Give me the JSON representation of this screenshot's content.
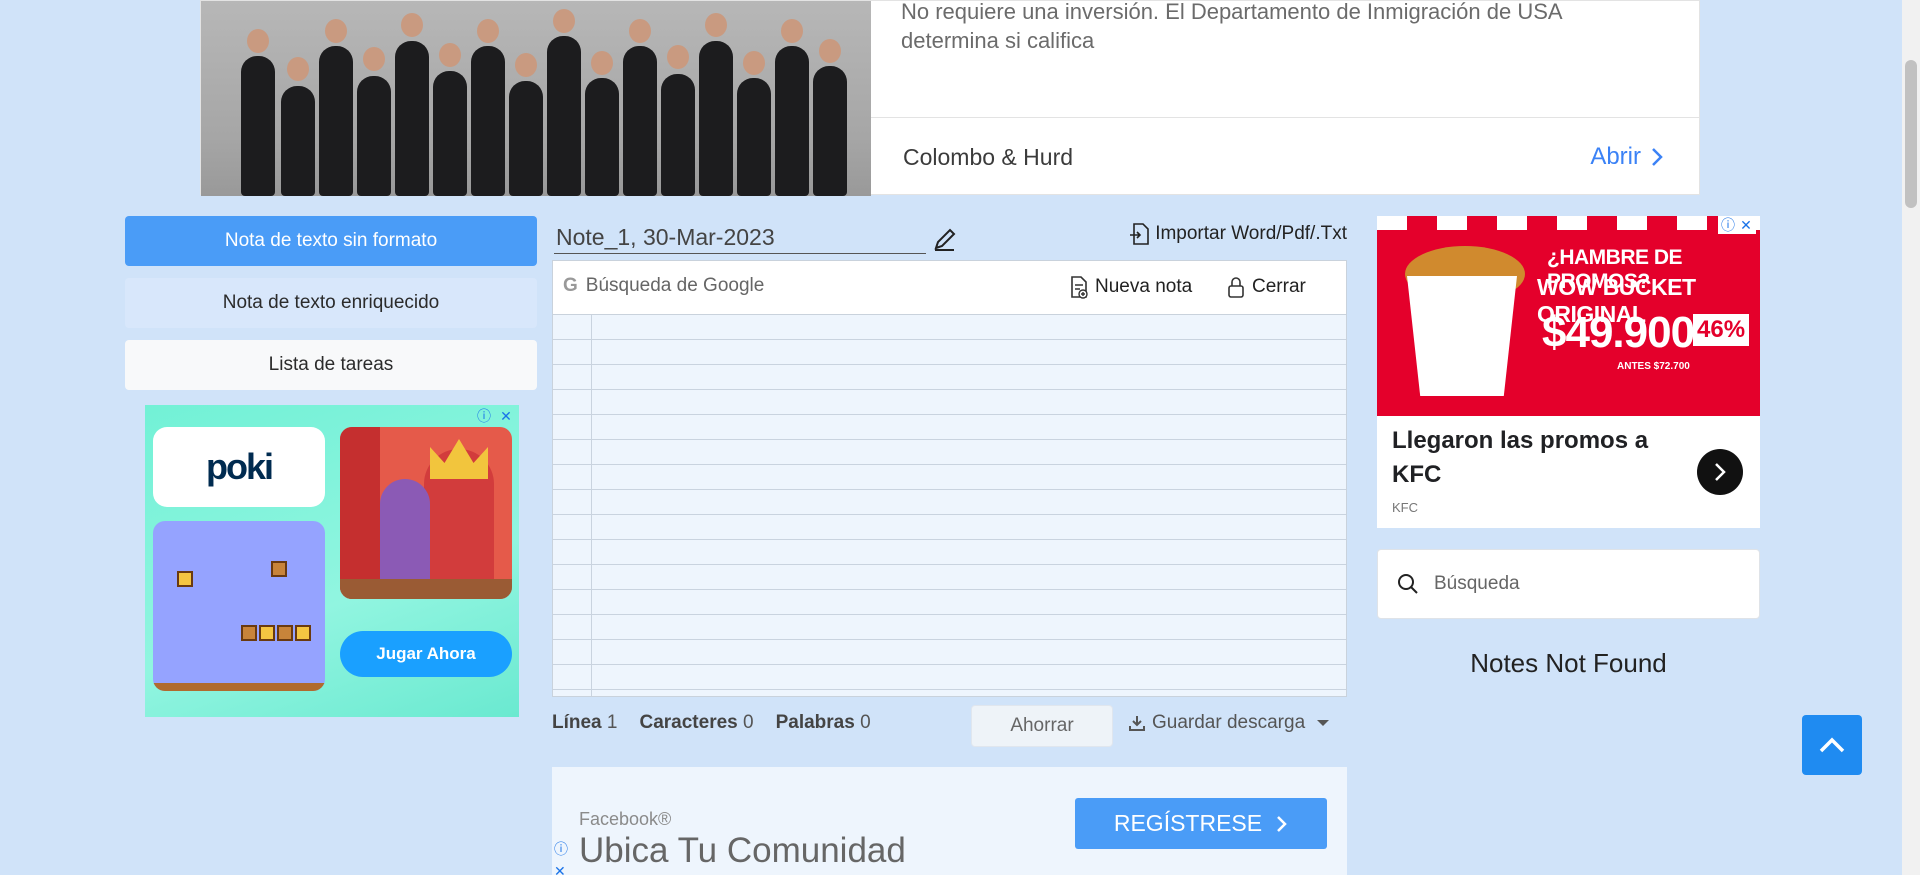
{
  "top_ad": {
    "copy": "No requiere una inversión. El Departamento de Inmigración de USA determina si califica",
    "advertiser": "Colombo & Hurd",
    "cta": "Abrir",
    "image_icon": "group-photo"
  },
  "left_tabs": {
    "plain_text": "Nota de texto sin formato",
    "rich_text": "Nota de texto enriquecido",
    "task_list": "Lista de tareas"
  },
  "poki_ad": {
    "logo": "poki",
    "play_button": "Jugar Ahora",
    "adchoice_info": "ⓘ",
    "adchoice_close": "✕"
  },
  "editor": {
    "note_title": "Note_1, 30-Mar-2023",
    "import_label": "Importar Word/Pdf/.Txt",
    "google_search_placeholder": "Búsqueda de Google",
    "google_icon": "G",
    "new_note": "Nueva nota",
    "close": "Cerrar"
  },
  "stats": {
    "line_label": "Línea",
    "line_value": "1",
    "chars_label": "Caracteres",
    "chars_value": "0",
    "words_label": "Palabras",
    "words_value": "0"
  },
  "actions": {
    "save": "Ahorrar",
    "download": "Guardar descarga"
  },
  "fb_ad": {
    "source": "Facebook®",
    "headline": "Ubica Tu Comunidad",
    "cta": "REGÍSTRESE"
  },
  "kfc_ad": {
    "promo_line1": "¿HAMBRE DE PROMOS?",
    "promo_line2": "WOW BUCKET ORIGINAL",
    "price": "$49.900",
    "discount": "46%",
    "before_price": "ANTES $72.700",
    "headline": "Llegaron las promos a KFC",
    "brand": "KFC"
  },
  "search": {
    "placeholder": "Búsqueda"
  },
  "notes_status": "Notes Not Found",
  "colors": {
    "page_bg": "#d0e3f9",
    "primary": "#4a9cf7",
    "back_to_top": "#1f8bf1",
    "kfc_red": "#e4002b"
  }
}
